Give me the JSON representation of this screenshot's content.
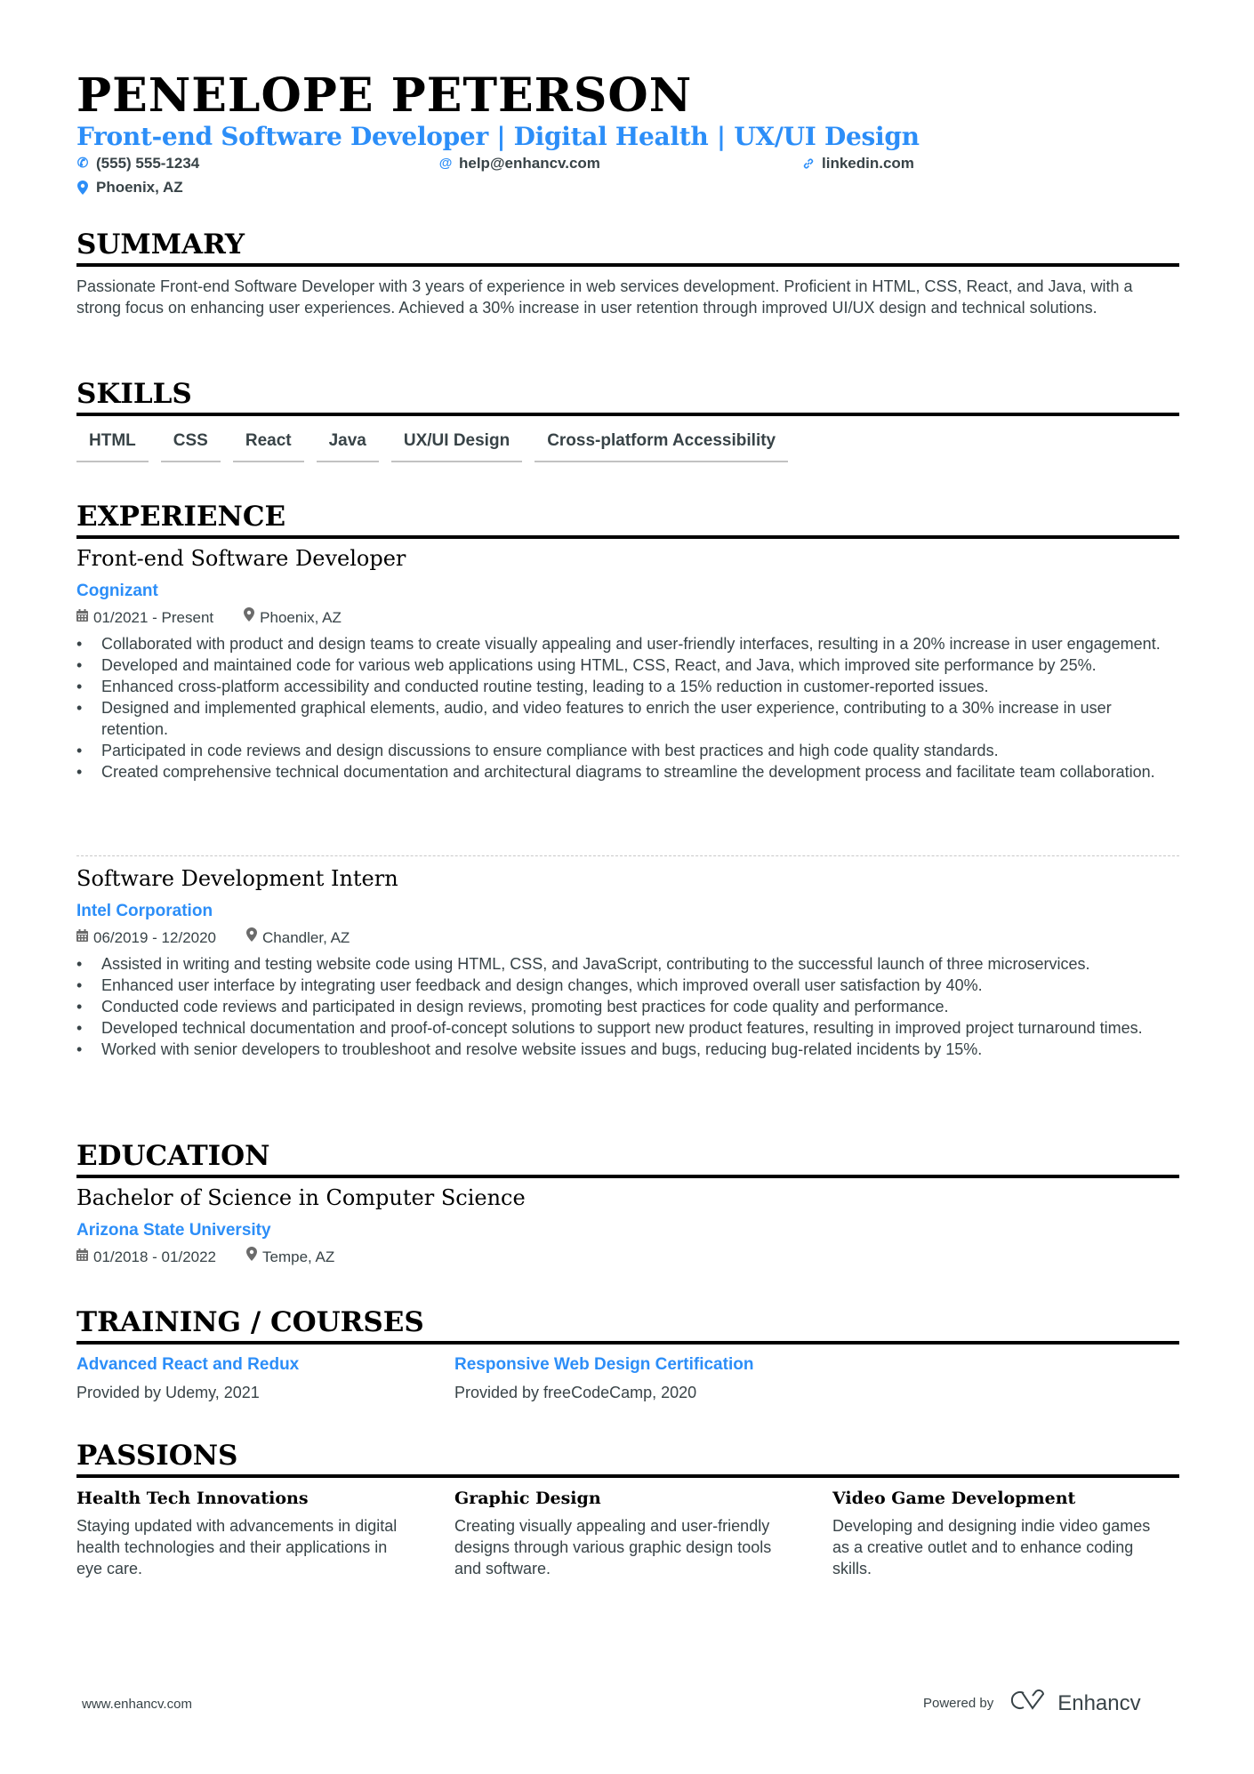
{
  "header": {
    "name": "PENELOPE PETERSON",
    "headline": "Front-end Software Developer | Digital Health | UX/UI Design",
    "contacts": {
      "phone": {
        "icon": "phone-icon",
        "value": "(555) 555-1234"
      },
      "email": {
        "icon": "at-icon",
        "value": "help@enhancv.com"
      },
      "linkedin": {
        "icon": "link-icon",
        "value": "linkedin.com"
      },
      "location": {
        "icon": "location-pin-icon",
        "value": "Phoenix, AZ"
      }
    }
  },
  "summary": {
    "title": "SUMMARY",
    "text": "Passionate Front-end Software Developer with 3 years of experience in web services development. Proficient in HTML, CSS, React, and Java, with a strong focus on enhancing user experiences. Achieved a 30% increase in user retention through improved UI/UX design and technical solutions."
  },
  "skills": {
    "title": "SKILLS",
    "items": [
      "HTML",
      "CSS",
      "React",
      "Java",
      "UX/UI Design",
      "Cross-platform Accessibility"
    ]
  },
  "experience": {
    "title": "EXPERIENCE",
    "items": [
      {
        "role": "Front-end Software Developer",
        "company": "Cognizant",
        "dates": "01/2021 - Present",
        "location": "Phoenix, AZ",
        "bullets": [
          "Collaborated with product and design teams to create visually appealing and user-friendly interfaces, resulting in a 20% increase in user engagement.",
          "Developed and maintained code for various web applications using HTML, CSS, React, and Java, which improved site performance by 25%.",
          "Enhanced cross-platform accessibility and conducted routine testing, leading to a 15% reduction in customer-reported issues.",
          "Designed and implemented graphical elements, audio, and video features to enrich the user experience, contributing to a 30% increase in user retention.",
          "Participated in code reviews and design discussions to ensure compliance with best practices and high code quality standards.",
          "Created comprehensive technical documentation and architectural diagrams to streamline the development process and facilitate team collaboration."
        ]
      },
      {
        "role": "Software Development Intern",
        "company": "Intel Corporation",
        "dates": "06/2019 - 12/2020",
        "location": "Chandler, AZ",
        "bullets": [
          "Assisted in writing and testing website code using HTML, CSS, and JavaScript, contributing to the successful launch of three microservices.",
          "Enhanced user interface by integrating user feedback and design changes, which improved overall user satisfaction by 40%.",
          "Conducted code reviews and participated in design reviews, promoting best practices for code quality and performance.",
          "Developed technical documentation and proof-of-concept solutions to support new product features, resulting in improved project turnaround times.",
          "Worked with senior developers to troubleshoot and resolve website issues and bugs, reducing bug-related incidents by 15%."
        ]
      }
    ]
  },
  "education": {
    "title": "EDUCATION",
    "degree": "Bachelor of Science in Computer Science",
    "school": "Arizona State University",
    "dates": "01/2018 - 01/2022",
    "location": "Tempe, AZ"
  },
  "training": {
    "title": "TRAINING / COURSES",
    "items": [
      {
        "title": "Advanced React and Redux",
        "provider": "Provided by Udemy, 2021"
      },
      {
        "title": "Responsive Web Design Certification",
        "provider": "Provided by freeCodeCamp, 2020"
      }
    ]
  },
  "passions": {
    "title": "PASSIONS",
    "items": [
      {
        "title": "Health Tech Innovations",
        "desc": "Staying updated with advancements in digital health technologies and their applications in eye care."
      },
      {
        "title": "Graphic Design",
        "desc": "Creating visually appealing and user-friendly designs through various graphic design tools and software."
      },
      {
        "title": "Video Game Development",
        "desc": "Developing and designing indie video games as a creative outlet and to enhance coding skills."
      }
    ]
  },
  "footer": {
    "website": "www.enhancv.com",
    "powered_by": "Powered by",
    "brand": "Enhancv"
  },
  "colors": {
    "accent": "#2c8ef8",
    "text": "#384347",
    "heading": "#000000"
  }
}
